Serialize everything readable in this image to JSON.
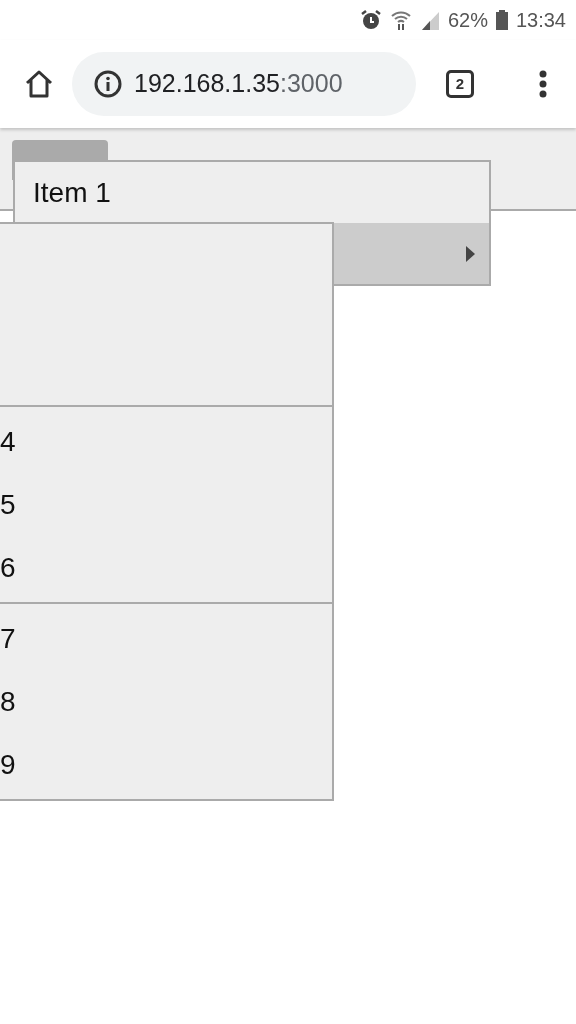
{
  "status_bar": {
    "battery": "62%",
    "time": "13:34"
  },
  "browser": {
    "url_host": "192.168.1.35",
    "url_port": ":3000",
    "tab_count": "2"
  },
  "menu_bar": {
    "items": [
      {
        "selected": true
      }
    ]
  },
  "dropdown": {
    "items": [
      {
        "label": "Item 1",
        "selected": false,
        "submenu": false
      },
      {
        "selected": true,
        "submenu": true
      }
    ]
  },
  "submenu": {
    "groups": [
      {
        "items": [
          "4",
          "5",
          "6"
        ]
      },
      {
        "items": [
          "7",
          "8",
          "9"
        ]
      }
    ]
  }
}
